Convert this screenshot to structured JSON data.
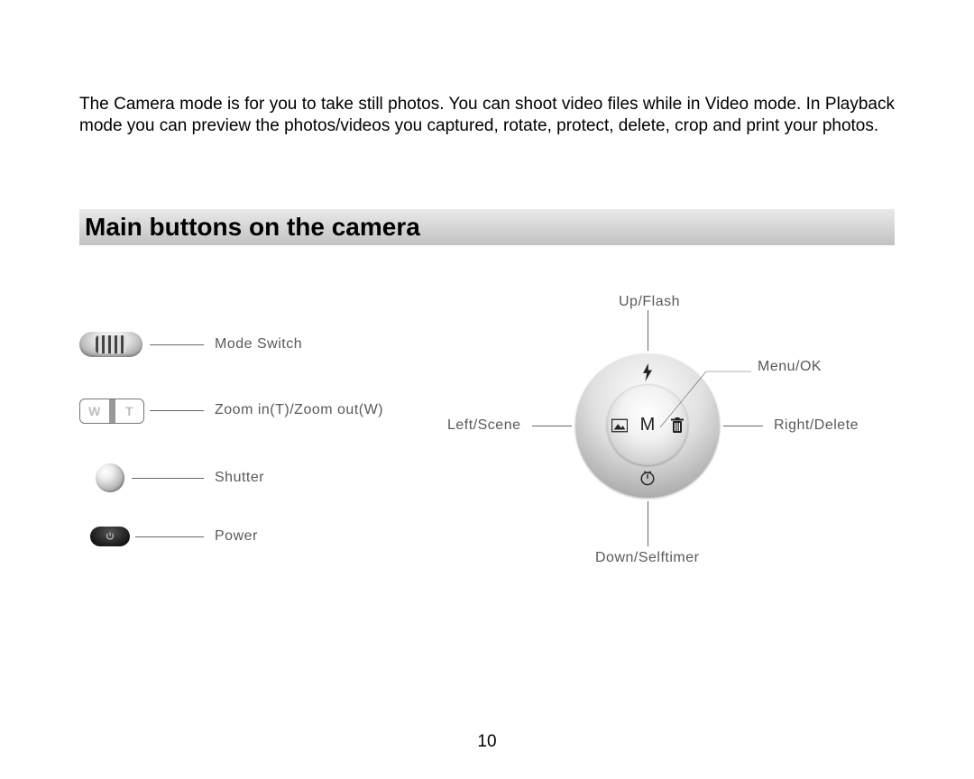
{
  "intro": "The Camera mode is for you to take still photos. You can shoot video files while in Video mode. In Playback mode you can preview the photos/videos you captured, rotate, protect, delete, crop and print your photos.",
  "heading": "Main buttons on the camera",
  "left_items": {
    "mode_switch": "Mode Switch",
    "zoom": "Zoom in(T)/Zoom out(W)",
    "shutter": "Shutter",
    "power": "Power"
  },
  "zoom_letters": {
    "w": "W",
    "t": "T"
  },
  "dial_labels": {
    "up": "Up/Flash",
    "right_top": "Menu/OK",
    "right": "Right/Delete",
    "down": "Down/Selftimer",
    "left": "Left/Scene",
    "center": "M"
  },
  "page_number": "10"
}
